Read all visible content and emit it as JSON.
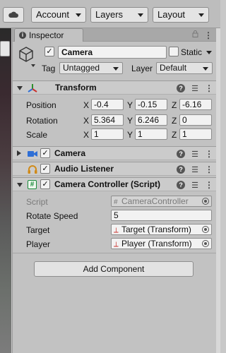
{
  "toolbar": {
    "account_label": "Account",
    "layers_label": "Layers",
    "layout_label": "Layout"
  },
  "inspector": {
    "tab_label": "Inspector",
    "object": {
      "active": true,
      "name": "Camera",
      "static_label": "Static",
      "static_checked": false,
      "tag_label": "Tag",
      "tag_value": "Untagged",
      "layer_label": "Layer",
      "layer_value": "Default"
    },
    "transform": {
      "title": "Transform",
      "position_label": "Position",
      "rotation_label": "Rotation",
      "scale_label": "Scale",
      "axis_x": "X",
      "axis_y": "Y",
      "axis_z": "Z",
      "position": {
        "x": "-0.4",
        "y": "-0.15",
        "z": "-6.16"
      },
      "rotation": {
        "x": "5.364",
        "y": "6.246",
        "z": "0"
      },
      "scale": {
        "x": "1",
        "y": "1",
        "z": "1"
      }
    },
    "camera": {
      "title": "Camera",
      "enabled": true
    },
    "audio_listener": {
      "title": "Audio Listener",
      "enabled": true
    },
    "camera_controller": {
      "title": "Camera Controller (Script)",
      "enabled": true,
      "script_label": "Script",
      "script_value": "CameraController",
      "rotate_speed_label": "Rotate Speed",
      "rotate_speed_value": "5",
      "target_label": "Target",
      "target_value": "Target (Transform)",
      "player_label": "Player",
      "player_value": "Player (Transform)"
    },
    "add_component_label": "Add Component"
  },
  "icons": {
    "cloud": "cloud-icon",
    "info": "info-icon",
    "lock": "lock-icon",
    "menu": "kebab-menu-icon",
    "cube": "gameobject-cube-icon",
    "transform": "transform-axes-icon",
    "camera": "camera-icon",
    "audio": "headphones-icon",
    "script": "script-hash-icon",
    "help": "help-icon",
    "presets": "presets-sliders-icon"
  },
  "colors": {
    "panel_bg": "#c2c2c2",
    "header_bg": "#cbcbcb",
    "field_bg": "#f2f2f2",
    "camera_icon_blue": "#2f6fd6",
    "audio_icon_orange": "#d08a18",
    "script_icon_green": "#1a8a3a"
  }
}
